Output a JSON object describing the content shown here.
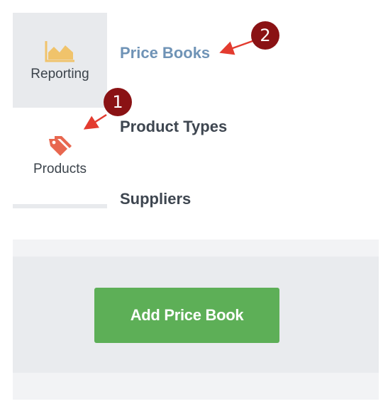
{
  "nav": {
    "reporting": {
      "label": "Reporting",
      "icon": "chart-icon"
    },
    "products": {
      "label": "Products",
      "icon": "tag-icon"
    }
  },
  "submenu": {
    "price_books": "Price Books",
    "product_types": "Product Types",
    "suppliers": "Suppliers"
  },
  "annotations": {
    "marker_1": "1",
    "marker_2": "2"
  },
  "panel": {
    "add_button_label": "Add Price Book"
  },
  "colors": {
    "active_link": "#6f93b6",
    "button": "#5daf57",
    "marker": "#8a1214",
    "arrow": "#e33b2f",
    "icon_reporting": "#f0c36b",
    "icon_products": "#e8674f"
  }
}
